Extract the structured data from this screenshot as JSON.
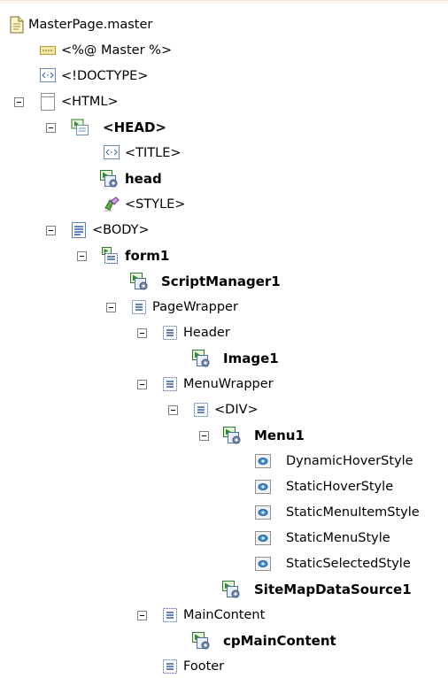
{
  "tree": {
    "nodes": [
      {
        "label": "MasterPage.master",
        "icon": "master-file-icon",
        "bold": false,
        "expanded": false
      },
      {
        "label": "<%@ Master %>",
        "icon": "directive-icon",
        "bold": false,
        "expanded": false
      },
      {
        "label": "<!DOCTYPE>",
        "icon": "tag-icon",
        "bold": false,
        "expanded": false
      },
      {
        "label": "<HTML>",
        "icon": "html-page-icon",
        "bold": false,
        "expanded": true
      },
      {
        "label": "<HEAD>",
        "icon": "server-control-icon",
        "bold": true,
        "expanded": true
      },
      {
        "label": "<TITLE>",
        "icon": "tag-icon",
        "bold": false,
        "expanded": false
      },
      {
        "label": "head",
        "icon": "content-placeholder-icon",
        "bold": true,
        "expanded": false
      },
      {
        "label": "<STYLE>",
        "icon": "style-icon",
        "bold": false,
        "expanded": false
      },
      {
        "label": "<BODY>",
        "icon": "body-icon",
        "bold": false,
        "expanded": true
      },
      {
        "label": "form1",
        "icon": "form-icon",
        "bold": true,
        "expanded": true
      },
      {
        "label": "ScriptManager1",
        "icon": "content-placeholder-icon",
        "bold": true,
        "expanded": false
      },
      {
        "label": "PageWrapper",
        "icon": "div-icon",
        "bold": false,
        "expanded": true
      },
      {
        "label": "Header",
        "icon": "div-icon",
        "bold": false,
        "expanded": true
      },
      {
        "label": "Image1",
        "icon": "content-placeholder-icon",
        "bold": true,
        "expanded": false
      },
      {
        "label": "MenuWrapper",
        "icon": "div-icon",
        "bold": false,
        "expanded": true
      },
      {
        "label": "<DIV>",
        "icon": "div-icon",
        "bold": false,
        "expanded": true
      },
      {
        "label": "Menu1",
        "icon": "content-placeholder-icon",
        "bold": true,
        "expanded": true
      },
      {
        "label": "DynamicHoverStyle",
        "icon": "style-property-icon",
        "bold": false,
        "expanded": false
      },
      {
        "label": "StaticHoverStyle",
        "icon": "style-property-icon",
        "bold": false,
        "expanded": false
      },
      {
        "label": "StaticMenuItemStyle",
        "icon": "style-property-icon",
        "bold": false,
        "expanded": false
      },
      {
        "label": "StaticMenuStyle",
        "icon": "style-property-icon",
        "bold": false,
        "expanded": false
      },
      {
        "label": "StaticSelectedStyle",
        "icon": "style-property-icon",
        "bold": false,
        "expanded": false
      },
      {
        "label": "SiteMapDataSource1",
        "icon": "content-placeholder-icon",
        "bold": true,
        "expanded": false
      },
      {
        "label": "MainContent",
        "icon": "div-icon",
        "bold": false,
        "expanded": true
      },
      {
        "label": "cpMainContent",
        "icon": "content-placeholder-icon",
        "bold": true,
        "expanded": false
      },
      {
        "label": "Footer",
        "icon": "div-icon",
        "bold": false,
        "expanded": false
      }
    ]
  }
}
